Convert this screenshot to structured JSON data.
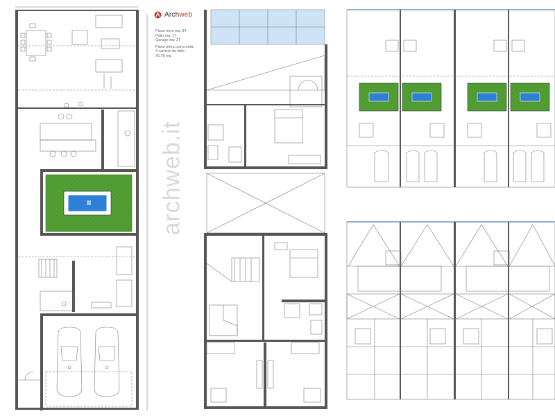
{
  "brand": {
    "name": "Archweb",
    "name_arch": "Arch",
    "name_web": "web",
    "watermark": "archweb.it",
    "colors": {
      "logo_red": "#c0392b",
      "accent_blue": "#4a7fc1"
    }
  },
  "areas": {
    "ground_floor": "Piano terra mq: 94",
    "patio": "Patio mq: 17",
    "garage": "Garage mq: 27",
    "first_floor_title": "Piano primo zona notte",
    "bedrooms": "4 camere da letto:",
    "first_floor_area": "76,78 mq"
  },
  "colors": {
    "wall": "#555555",
    "line": "#777777",
    "lawn": "#4f9a31",
    "pool_water": "#2e7fd6",
    "glass": "#cfe3f7",
    "window": "#4a7fc1"
  }
}
